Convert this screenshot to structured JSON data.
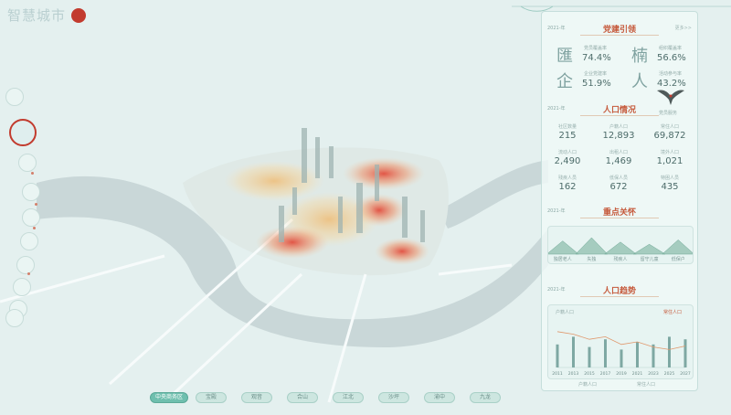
{
  "brand": {
    "title": "智慧城市"
  },
  "colors": {
    "accent": "#c65a3c",
    "teal": "#6fbfae",
    "heat": "#e0573a",
    "panel": "#f0f9f8"
  },
  "left_nav": [
    {
      "label": ""
    },
    {
      "label": ""
    },
    {
      "label": ""
    },
    {
      "label": ""
    },
    {
      "label": ""
    },
    {
      "label": ""
    },
    {
      "label": ""
    },
    {
      "label": ""
    },
    {
      "label": ""
    },
    {
      "label": ""
    }
  ],
  "panel": {
    "sec1": {
      "title": "党建引领",
      "year": "2021-年",
      "more": "更多>>"
    },
    "stats": [
      {
        "icon": "匯",
        "label": "党员覆盖率",
        "value": "74.4%"
      },
      {
        "icon": "楠",
        "label": "组织覆盖率",
        "value": "56.6%"
      },
      {
        "icon": "企",
        "label": "企业党建率",
        "value": "51.9%"
      },
      {
        "icon": "人",
        "label": "活动参与率",
        "value": "43.2%"
      }
    ],
    "bird_label": "党员服务",
    "sec2": {
      "title": "人口情况",
      "year": "2021-年",
      "more": "更多>>"
    },
    "pop": [
      {
        "label": "社区数量",
        "value": "215"
      },
      {
        "label": "户籍人口",
        "value": "12,893"
      },
      {
        "label": "常住人口",
        "value": "69,872"
      },
      {
        "label": "流动人口",
        "value": "2,490"
      },
      {
        "label": "出租人口",
        "value": "1,469"
      },
      {
        "label": "境外人口",
        "value": "1,021"
      },
      {
        "label": "残疾人员",
        "value": "162"
      },
      {
        "label": "低保人员",
        "value": "672"
      },
      {
        "label": "特困人员",
        "value": "435"
      }
    ],
    "sec3": {
      "title": "重点关怀",
      "year": "2021-年",
      "more": "更多>>"
    },
    "care": {
      "labels": [
        "独居老人",
        "失独",
        "残疾人",
        "留守儿童",
        "低保户"
      ],
      "values": [
        60,
        75,
        55,
        45,
        65
      ]
    },
    "sec4": {
      "title": "人口趋势",
      "year": "2021-年",
      "more": "更多>>"
    },
    "trend": {
      "legend_left": "户籍人口",
      "legend_right": "常住人口",
      "x": [
        "2011",
        "2013",
        "2015",
        "2017",
        "2019",
        "2021",
        "2023",
        "2025",
        "2027"
      ],
      "bars": [
        45,
        60,
        40,
        55,
        35,
        50,
        45,
        60,
        55
      ],
      "line": [
        70,
        65,
        55,
        60,
        45,
        50,
        40,
        35,
        42
      ],
      "xlabel_left": "户籍人口",
      "xlabel_right": "常住人口"
    }
  },
  "bottom_nav": [
    {
      "label": "中央商务区",
      "active": true
    },
    {
      "label": "宝殿",
      "active": false
    },
    {
      "label": "观音",
      "active": false
    },
    {
      "label": "合山",
      "active": false
    },
    {
      "label": "江北",
      "active": false
    },
    {
      "label": "沙坪",
      "active": false
    },
    {
      "label": "渝中",
      "active": false
    },
    {
      "label": "九龙",
      "active": false
    }
  ]
}
